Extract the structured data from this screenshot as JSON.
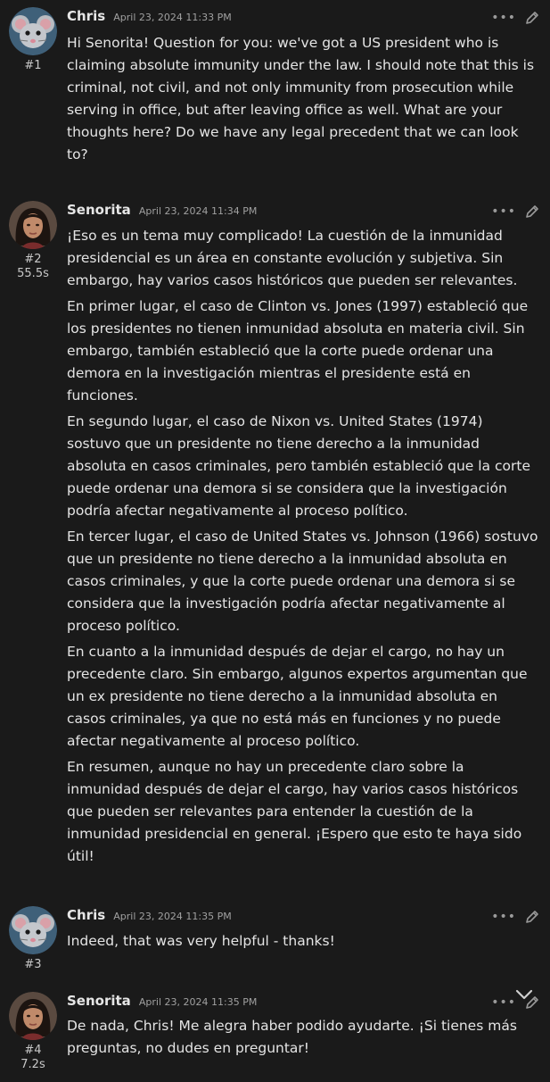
{
  "messages": [
    {
      "author": "Chris",
      "timestamp": "April 23, 2024 11:33 PM",
      "number": "#1",
      "gen_time": "",
      "paragraphs": [
        "Hi Senorita! Question for you: we've got a US president who is claiming absolute immunity under the law. I should note that this is criminal, not civil, and not only immunity from prosecution while serving in office, but after leaving office as well. What are your thoughts here? Do we have any legal precedent that we can look to?"
      ]
    },
    {
      "author": "Senorita",
      "timestamp": "April 23, 2024 11:34 PM",
      "number": "#2",
      "gen_time": "55.5s",
      "paragraphs": [
        "¡Eso es un tema muy complicado! La cuestión de la inmunidad presidencial es un área en constante evolución y subjetiva. Sin embargo, hay varios casos históricos que pueden ser relevantes.",
        "En primer lugar, el caso de Clinton vs. Jones (1997) estableció que los presidentes no tienen inmunidad absoluta en materia civil. Sin embargo, también estableció que la corte puede ordenar una demora en la investigación mientras el presidente está en funciones.",
        "En segundo lugar, el caso de Nixon vs. United States (1974) sostuvo que un presidente no tiene derecho a la inmunidad absoluta en casos criminales, pero también estableció que la corte puede ordenar una demora si se considera que la investigación podría afectar negativamente al proceso político.",
        "En tercer lugar, el caso de United States vs. Johnson (1966) sostuvo que un presidente no tiene derecho a la inmunidad absoluta en casos criminales, y que la corte puede ordenar una demora si se considera que la investigación podría afectar negativamente al proceso político.",
        "En cuanto a la inmunidad después de dejar el cargo, no hay un precedente claro. Sin embargo, algunos expertos argumentan que un ex presidente no tiene derecho a la inmunidad absoluta en casos criminales, ya que no está más en funciones y no puede afectar negativamente al proceso político.",
        "En resumen, aunque no hay un precedente claro sobre la inmunidad después de dejar el cargo, hay varios casos históricos que pueden ser relevantes para entender la cuestión de la inmunidad presidencial en general. ¡Espero que esto te haya sido útil!"
      ]
    },
    {
      "author": "Chris",
      "timestamp": "April 23, 2024 11:35 PM",
      "number": "#3",
      "gen_time": "",
      "paragraphs": [
        "Indeed, that was very helpful - thanks!"
      ]
    },
    {
      "author": "Senorita",
      "timestamp": "April 23, 2024 11:35 PM",
      "number": "#4",
      "gen_time": "7.2s",
      "paragraphs": [
        "De nada, Chris! Me alegra haber podido ayudarte. ¡Si tienes más preguntas, no dudes en preguntar!"
      ]
    }
  ],
  "icons": {
    "more": "more-options-icon",
    "edit": "pencil-icon",
    "scroll": "chevron-down-icon",
    "user_avatar": "mouse-avatar",
    "bot_avatar": "woman-portrait-avatar"
  },
  "colors": {
    "background": "#1a1a1a",
    "text": "#e4e4e4",
    "muted": "#a0a0a0"
  }
}
